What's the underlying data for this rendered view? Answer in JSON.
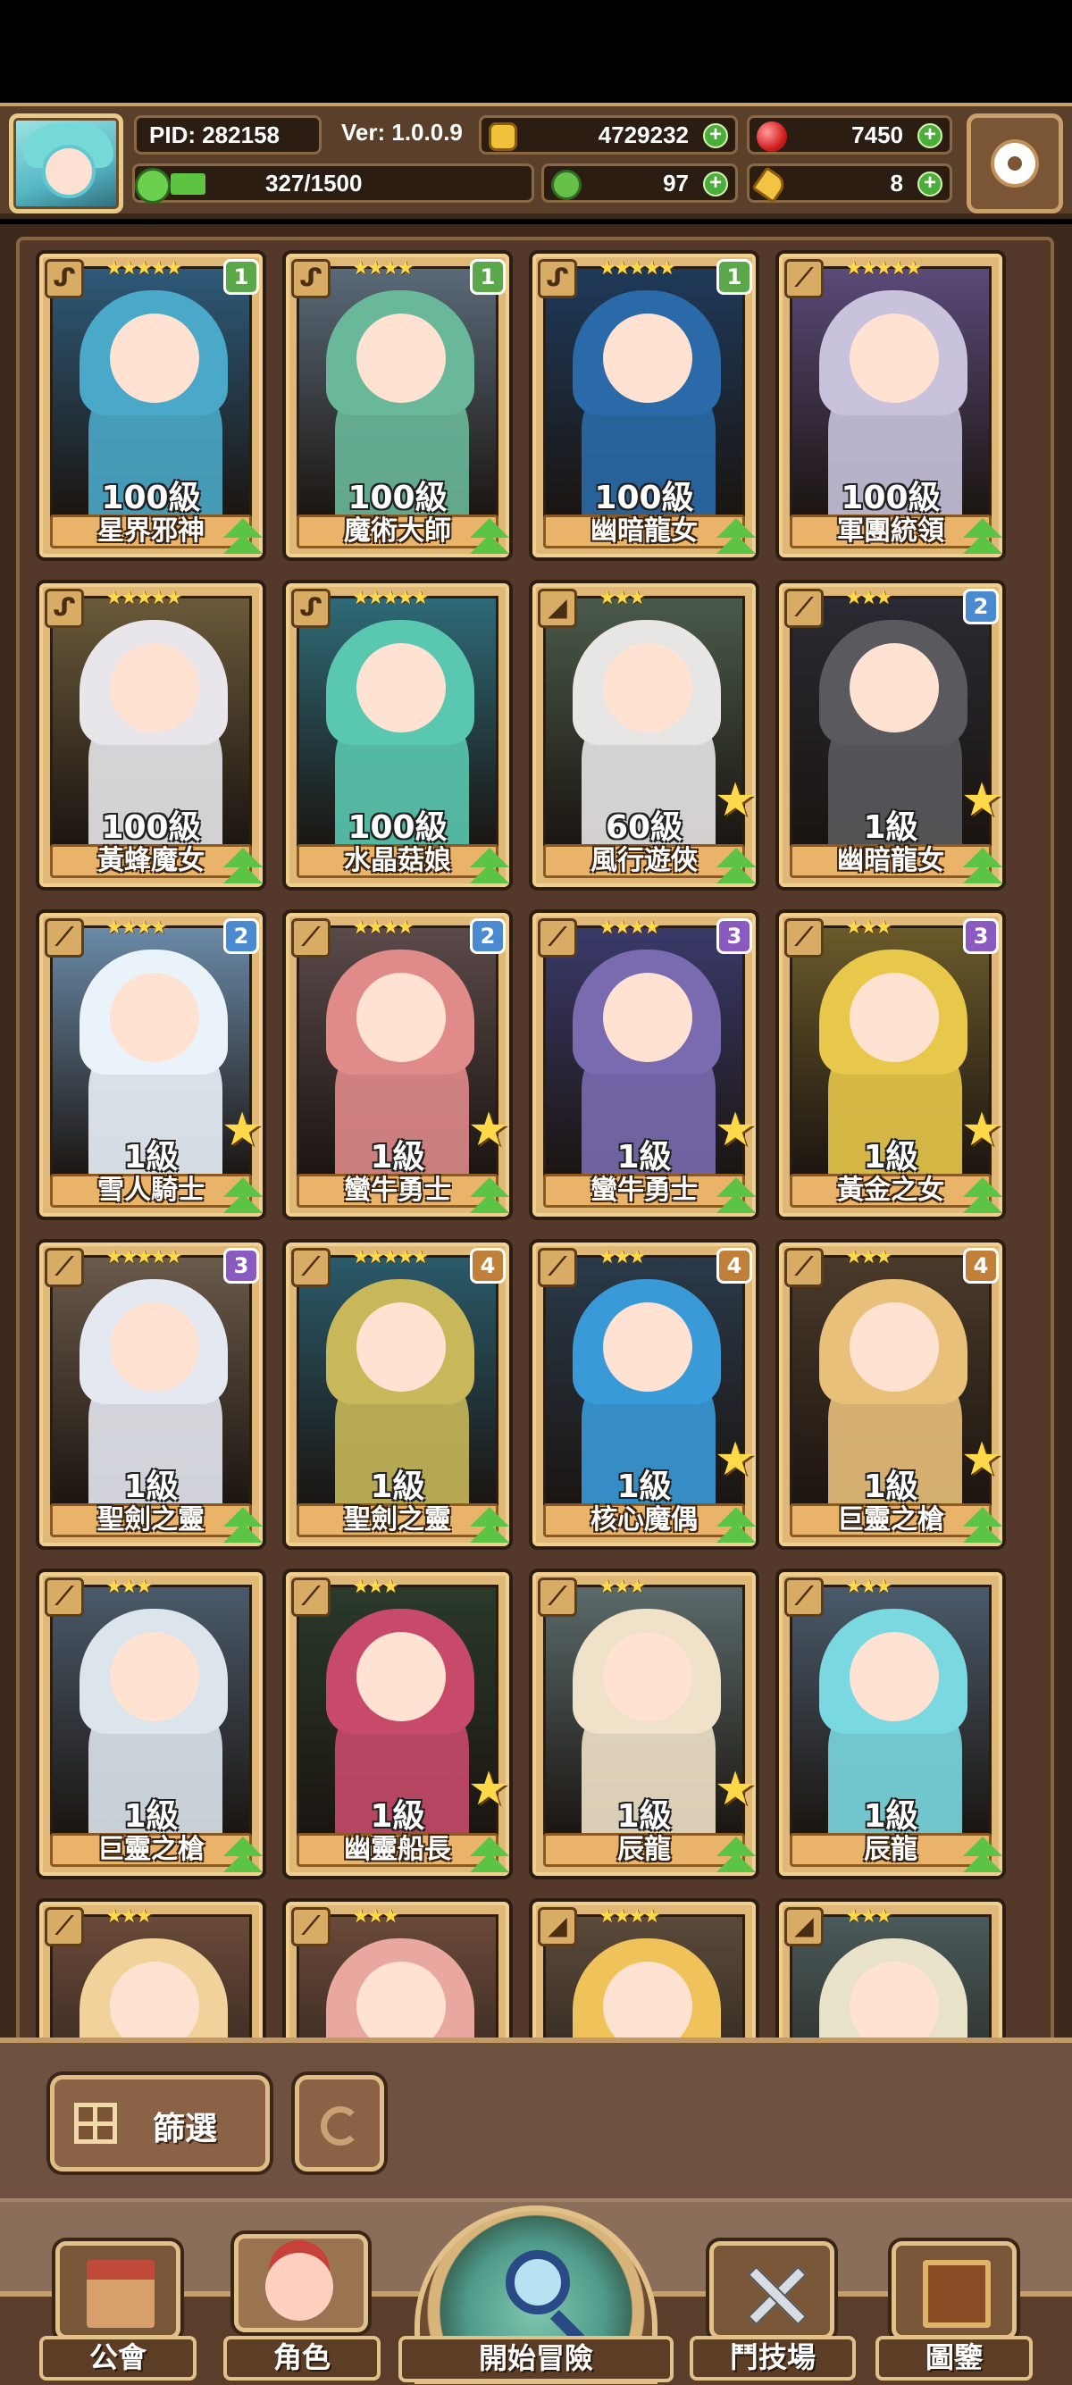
{
  "header": {
    "pid_label": "PID: 282158",
    "version_label": "Ver: 1.0.0.9",
    "gold": "4729232",
    "gems": "7450",
    "energy": "327/1500",
    "energy_fraction": 0.218,
    "clover": "97",
    "keys": "8"
  },
  "colors": {
    "accent_gold": "#e0b878",
    "panel_brown": "#5a3f2a",
    "plus_green": "#4cae3a"
  },
  "cards": [
    {
      "name": "星界邪神",
      "level": "100級",
      "stars": "★★★★★",
      "rank": "1",
      "rank_color": "#5aa84a",
      "type_icon": "staff-icon",
      "hair": "#4aa8c8",
      "bg": "#2e5a78",
      "up": false
    },
    {
      "name": "魔術大師",
      "level": "100級",
      "stars": "★★★★",
      "rank": "1",
      "rank_color": "#5aa84a",
      "type_icon": "staff-icon",
      "hair": "#6ab89a",
      "bg": "#5a6a78",
      "up": false
    },
    {
      "name": "幽暗龍女",
      "level": "100級",
      "stars": "★★★★★",
      "rank": "1",
      "rank_color": "#5aa84a",
      "type_icon": "staff-icon",
      "hair": "#2a6aa8",
      "bg": "#1e3a5a",
      "up": false
    },
    {
      "name": "軍團統領",
      "level": "100級",
      "stars": "★★★★★",
      "rank": "",
      "rank_color": "",
      "type_icon": "sword-icon",
      "hair": "#c8c2dc",
      "bg": "#5a4a78",
      "up": false
    },
    {
      "name": "黃蜂魔女",
      "level": "100級",
      "stars": "★★★★★",
      "rank": "",
      "rank_color": "",
      "type_icon": "staff-icon",
      "hair": "#e8e6ea",
      "bg": "#6a5a3a",
      "up": false
    },
    {
      "name": "水晶菇娘",
      "level": "100級",
      "stars": "★★★★★",
      "rank": "",
      "rank_color": "",
      "type_icon": "staff-icon",
      "hair": "#5ac8b0",
      "bg": "#2e6a78",
      "up": false
    },
    {
      "name": "風行遊俠",
      "level": "60級",
      "stars": "★★★",
      "rank": "",
      "rank_color": "",
      "type_icon": "bow-icon",
      "hair": "#e8e6e4",
      "bg": "#4a5a4a",
      "up": true
    },
    {
      "name": "幽暗龍女",
      "level": "1級",
      "stars": "★★★",
      "rank": "2",
      "rank_color": "#4a8ad0",
      "type_icon": "sword-icon",
      "hair": "#5a5a5e",
      "bg": "#2a2a32",
      "up": true
    },
    {
      "name": "雪人騎士",
      "level": "1級",
      "stars": "★★★★",
      "rank": "2",
      "rank_color": "#4a8ad0",
      "type_icon": "sword-icon",
      "hair": "#eaf2fa",
      "bg": "#6a8aa8",
      "up": true
    },
    {
      "name": "蠻牛勇士",
      "level": "1級",
      "stars": "★★★★",
      "rank": "2",
      "rank_color": "#4a8ad0",
      "type_icon": "sword-icon",
      "hair": "#e08a8a",
      "bg": "#5a4a4a",
      "up": true
    },
    {
      "name": "蠻牛勇士",
      "level": "1級",
      "stars": "★★★★",
      "rank": "3",
      "rank_color": "#8a5ac0",
      "type_icon": "sword-icon",
      "hair": "#7a6ab0",
      "bg": "#3a3a6a",
      "up": true
    },
    {
      "name": "黃金之女",
      "level": "1級",
      "stars": "★★★",
      "rank": "3",
      "rank_color": "#8a5ac0",
      "type_icon": "sword-icon",
      "hair": "#e8c84a",
      "bg": "#6a5a2a",
      "up": true
    },
    {
      "name": "聖劍之靈",
      "level": "1級",
      "stars": "★★★★★",
      "rank": "3",
      "rank_color": "#8a5ac0",
      "type_icon": "sword-icon",
      "hair": "#e4e8f0",
      "bg": "#6a5a4a",
      "up": false
    },
    {
      "name": "聖劍之靈",
      "level": "1級",
      "stars": "★★★★★",
      "rank": "4",
      "rank_color": "#c0803a",
      "type_icon": "sword-icon",
      "hair": "#c8b85a",
      "bg": "#2a5a6a",
      "up": false
    },
    {
      "name": "核心魔偶",
      "level": "1級",
      "stars": "★★★",
      "rank": "4",
      "rank_color": "#c0803a",
      "type_icon": "sword-icon",
      "hair": "#3a9ad8",
      "bg": "#2a3a4a",
      "up": true
    },
    {
      "name": "巨靈之槍",
      "level": "1級",
      "stars": "★★★",
      "rank": "4",
      "rank_color": "#c0803a",
      "type_icon": "sword-icon",
      "hair": "#e8c07a",
      "bg": "#4a3a2a",
      "up": true
    },
    {
      "name": "巨靈之槍",
      "level": "1級",
      "stars": "★★★",
      "rank": "",
      "rank_color": "",
      "type_icon": "sword-icon",
      "hair": "#dce4ec",
      "bg": "#4a5a6a",
      "up": false
    },
    {
      "name": "幽靈船長",
      "level": "1級",
      "stars": "★★★",
      "rank": "",
      "rank_color": "",
      "type_icon": "sword-icon",
      "hair": "#c84a6a",
      "bg": "#2a3a2a",
      "up": true
    },
    {
      "name": "辰龍",
      "level": "1級",
      "stars": "★★★",
      "rank": "",
      "rank_color": "",
      "type_icon": "sword-icon",
      "hair": "#f0e2c8",
      "bg": "#5a6a6a",
      "up": true
    },
    {
      "name": "辰龍",
      "level": "1級",
      "stars": "★★★",
      "rank": "",
      "rank_color": "",
      "type_icon": "sword-icon",
      "hair": "#7ad8e0",
      "bg": "#4a5a6a",
      "up": false
    },
    {
      "name": "",
      "level": "",
      "stars": "★★★",
      "rank": "",
      "rank_color": "",
      "type_icon": "sword-icon",
      "hair": "#f0d29a",
      "bg": "#6a4a3a",
      "up": false
    },
    {
      "name": "",
      "level": "",
      "stars": "★★★",
      "rank": "",
      "rank_color": "",
      "type_icon": "sword-icon",
      "hair": "#e8a8a0",
      "bg": "#6a4a3a",
      "up": false
    },
    {
      "name": "",
      "level": "",
      "stars": "★★★★",
      "rank": "",
      "rank_color": "",
      "type_icon": "bow-icon",
      "hair": "#f0c25a",
      "bg": "#5a4a3a",
      "up": false
    },
    {
      "name": "",
      "level": "",
      "stars": "★★★",
      "rank": "",
      "rank_color": "",
      "type_icon": "bow-icon",
      "hair": "#e8e2c8",
      "bg": "#4a5a5a",
      "up": false
    }
  ],
  "filter": {
    "filter_label": "篩選"
  },
  "nav": {
    "guild": "公會",
    "role": "角色",
    "adventure": "開始冒險",
    "arena": "鬥技場",
    "codex": "圖鑒"
  }
}
